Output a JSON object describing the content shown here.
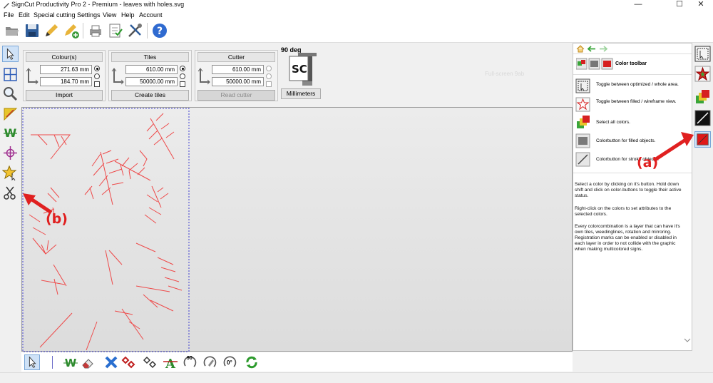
{
  "window": {
    "title": "SignCut Productivity Pro 2 - Premium  - leaves with holes.svg",
    "minimize": "—",
    "maximize": "☐",
    "close": "✕"
  },
  "menu": [
    "File",
    "Edit",
    "Special cutting",
    "Settings",
    "View",
    "Help",
    "Account"
  ],
  "toolbar": {
    "icons": [
      "open-folder-icon",
      "save-icon",
      "pencil-icon",
      "pencil-add-icon",
      "printer-icon",
      "checklist-icon",
      "tools-icon",
      "help-icon"
    ]
  },
  "left_toolbar": {
    "icons": [
      "pointer-icon",
      "grid-icon",
      "magnifier-icon",
      "weed-triangle-icon",
      "weeding-w-icon",
      "registration-mark-icon",
      "star-icon",
      "scissors-icon"
    ]
  },
  "colours_panel": {
    "header": "Colour(s)",
    "width": "271.63 mm",
    "height": "184.70 mm",
    "button": "Import"
  },
  "tiles_panel": {
    "header": "Tiles",
    "width": "610.00 mm",
    "height": "50000.00 mm",
    "button": "Create tiles"
  },
  "cutter_panel": {
    "header": "Cutter",
    "width": "610.00 mm",
    "height": "50000.00 mm",
    "button": "Read cutter"
  },
  "rotation": {
    "label": "90 deg",
    "logo": "SC",
    "units_button": "Millimeters"
  },
  "fullscreen_hint": "Full-screen 9ab",
  "right_panel": {
    "title": "Color toolbar",
    "items": [
      {
        "icon": "optimized-toggle-icon",
        "text": "Toggle between optimized / whole area."
      },
      {
        "icon": "filled-wireframe-icon",
        "text": "Toggle between filled / wireframe view."
      },
      {
        "icon": "select-colors-icon",
        "text": "Select all colors."
      },
      {
        "icon": "filled-colorbutton-icon",
        "text": "Colorbutton for filled objects."
      },
      {
        "icon": "stroke-colorbutton-icon",
        "text": "Colorbutton for stroke objects."
      }
    ],
    "para1": "Select a color by clicking on it's button. Hold down shift and click on color-buttons to toggle their active status.",
    "para2": "Right-click on the colors to set attributes to the selected colors.",
    "para3": "Every colorcombination is a layer that can have it's own tiles, weedinglines, rotation and mirroring. Registration marks can be enabled or disabled in each layer in order to not collide with the graphic when making multicolored signs."
  },
  "right_toolbar": {
    "icons": [
      "cursor-box-icon",
      "star-color-icon",
      "color-layers-icon",
      "black-stroke-icon",
      "red-color-icon"
    ]
  },
  "bottom_toolbar": {
    "icons": [
      "pointer-icon",
      "weeding-w-icon",
      "eraser-icon",
      "blue-x-icon",
      "red-diamonds-icon",
      "outline-diamonds-icon",
      "text-weed-icon",
      "rotate-90-icon",
      "rotate-pen-icon",
      "rotate-zero-icon",
      "refresh-icon"
    ],
    "rotate_90": "90",
    "rotate_zero": "0°"
  },
  "annotations": {
    "a": "(a)",
    "b": "(b)"
  },
  "colors": {
    "accent": "#e02020",
    "selection": "#3a3ad6"
  }
}
